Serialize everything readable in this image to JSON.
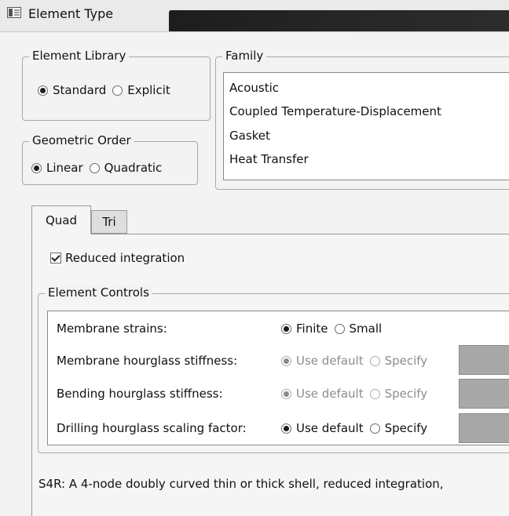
{
  "window": {
    "title": "Element Type"
  },
  "element_library": {
    "legend": "Element Library",
    "options": [
      {
        "label": "Standard",
        "selected": true
      },
      {
        "label": "Explicit",
        "selected": false
      }
    ]
  },
  "geometric_order": {
    "legend": "Geometric Order",
    "options": [
      {
        "label": "Linear",
        "selected": true
      },
      {
        "label": "Quadratic",
        "selected": false
      }
    ]
  },
  "family": {
    "legend": "Family",
    "items": [
      "Acoustic",
      "Coupled Temperature-Displacement",
      "Gasket",
      "Heat Transfer"
    ]
  },
  "tabs": [
    {
      "label": "Quad",
      "active": true
    },
    {
      "label": "Tri",
      "active": false
    }
  ],
  "reduced_integration": {
    "label": "Reduced integration",
    "checked": true
  },
  "element_controls": {
    "legend": "Element Controls",
    "rows": [
      {
        "label": "Membrane strains:",
        "opt1": "Finite",
        "opt2": "Small",
        "selected": "opt1",
        "enabled": true,
        "has_field": false
      },
      {
        "label": "Membrane hourglass stiffness:",
        "opt1": "Use default",
        "opt2": "Specify",
        "selected": "opt1",
        "enabled": false,
        "has_field": true
      },
      {
        "label": "Bending hourglass stiffness:",
        "opt1": "Use default",
        "opt2": "Specify",
        "selected": "opt1",
        "enabled": false,
        "has_field": true
      },
      {
        "label": "Drilling hourglass scaling factor:",
        "opt1": "Use default",
        "opt2": "Specify",
        "selected": "opt1",
        "enabled": true,
        "has_field": true
      }
    ]
  },
  "description": "S4R:  A 4-node doubly curved thin or thick shell, reduced integration,"
}
